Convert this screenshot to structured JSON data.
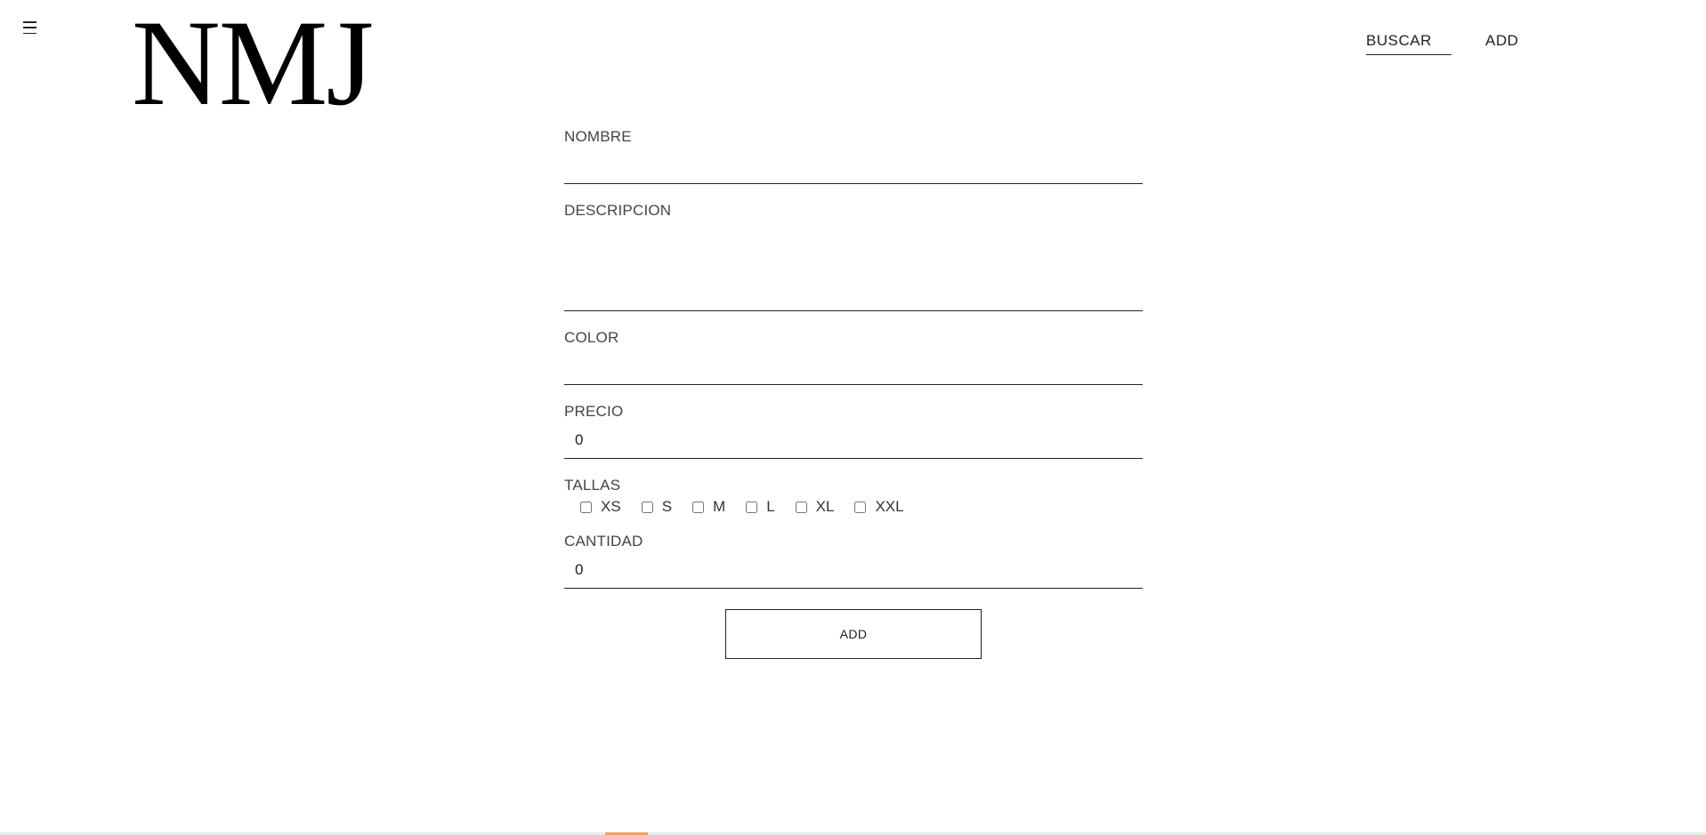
{
  "header": {
    "logo": "NMJ",
    "menu_icon": "hamburger-menu-icon",
    "nav": [
      {
        "label": "BUSCAR",
        "active": true
      },
      {
        "label": "ADD",
        "active": false
      }
    ]
  },
  "form": {
    "nombre": {
      "label": "NOMBRE",
      "value": ""
    },
    "descripcion": {
      "label": "DESCRIPCION",
      "value": ""
    },
    "color": {
      "label": "COLOR",
      "value": ""
    },
    "precio": {
      "label": "PRECIO",
      "value": "0"
    },
    "tallas": {
      "label": "TALLAS",
      "options": [
        "XS",
        "S",
        "M",
        "L",
        "XL",
        "XXL"
      ]
    },
    "cantidad": {
      "label": "CANTIDAD",
      "value": "0"
    },
    "submit_label": "ADD"
  },
  "colors": {
    "text": "#222222",
    "background": "#ffffff",
    "strip": "#e7efee",
    "strip_accent": "#e9a26a"
  }
}
